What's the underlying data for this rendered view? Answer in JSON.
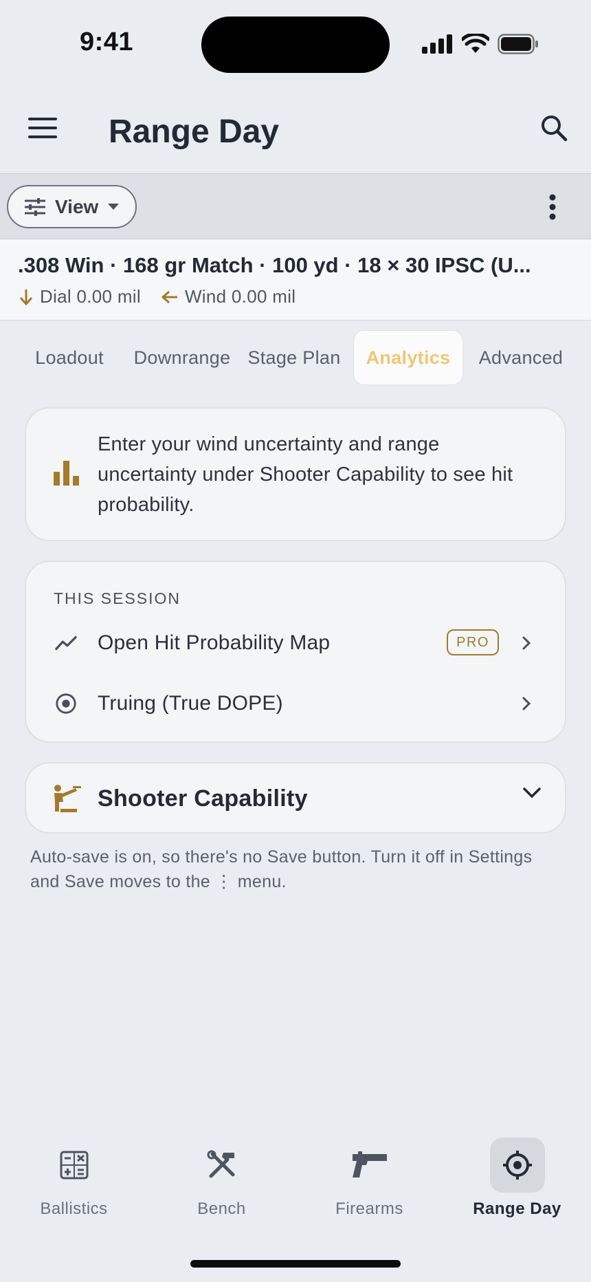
{
  "status_bar": {
    "time": "9:41"
  },
  "app_bar": {
    "title": "Range Day"
  },
  "toolbar": {
    "view_label": "View"
  },
  "summary": {
    "title": ".308 Win · 168 gr Match · 100 yd · 18 × 30 IPSC (U...",
    "dial": "Dial 0.00 mil",
    "wind": "Wind 0.00 mil"
  },
  "tabs": [
    {
      "label": "Loadout"
    },
    {
      "label": "Downrange"
    },
    {
      "label": "Stage Plan"
    },
    {
      "label": "Analytics",
      "active": true
    },
    {
      "label": "Advanced"
    }
  ],
  "info_card": {
    "text": "Enter your wind uncertainty and range uncertainty under Shooter Capability to see hit probability.",
    "icon": "bar-chart-icon"
  },
  "session": {
    "section_label": "THIS SESSION",
    "rows": [
      {
        "label": "Open Hit Probability Map",
        "badge": "PRO",
        "icon": "trend-line-icon"
      },
      {
        "label": "Truing (True DOPE)",
        "icon": "target-circle-icon"
      }
    ]
  },
  "capability": {
    "title": "Shooter Capability",
    "icon": "shooter-icon"
  },
  "autosave_note": "Auto-save is on, so there's no Save button. Turn it off in Settings and Save moves to the ⋮ menu.",
  "bottom_nav": [
    {
      "label": "Ballistics",
      "icon": "calculator-icon"
    },
    {
      "label": "Bench",
      "icon": "tools-icon"
    },
    {
      "label": "Firearms",
      "icon": "pistol-icon"
    },
    {
      "label": "Range Day",
      "icon": "crosshair-icon",
      "active": true
    }
  ],
  "colors": {
    "accent_gold": "#a57a2c",
    "active_tab_text": "#efc774",
    "background": "#e9ecf0",
    "text_primary": "#232a36"
  }
}
